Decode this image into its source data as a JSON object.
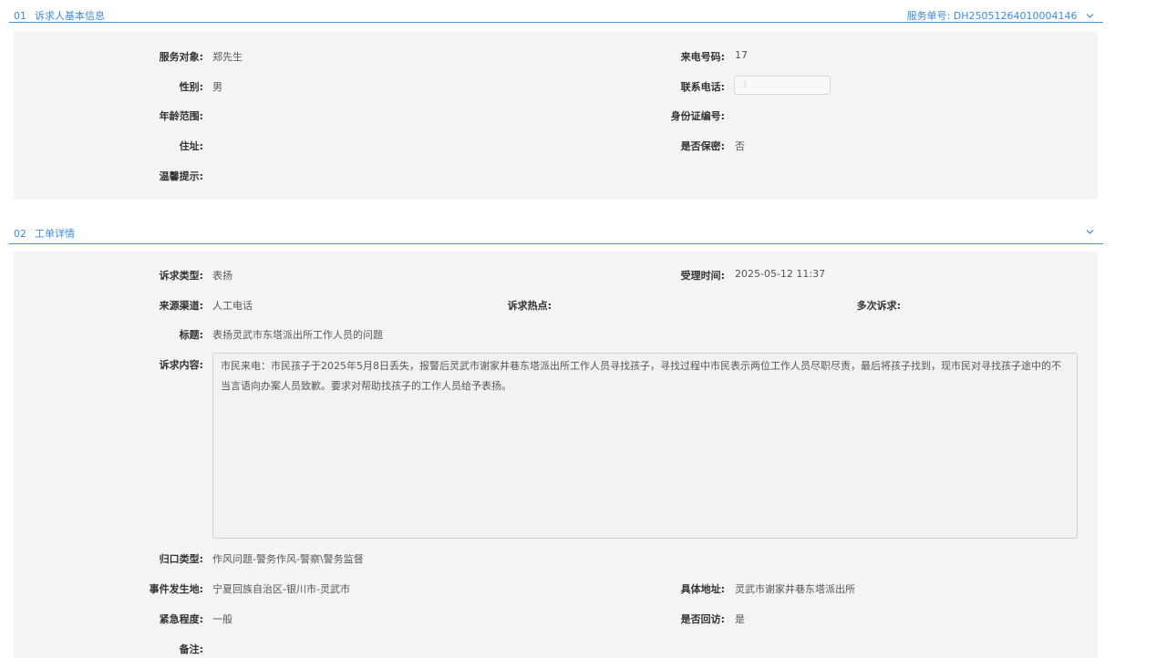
{
  "section1": {
    "num": "01",
    "title": "诉求人基本信息",
    "service_no_label": "服务单号:",
    "service_no": "DH25051264010004146",
    "fields": {
      "service_target_label": "服务对象:",
      "service_target": "郑先生",
      "caller_no_label": "来电号码:",
      "caller_no": "17",
      "gender_label": "性别:",
      "gender": "男",
      "contact_phone_label": "联系电话:",
      "contact_phone": "1",
      "age_range_label": "年龄范围:",
      "age_range": "",
      "id_no_label": "身份证编号:",
      "id_no": "",
      "address_label": "住址:",
      "address": "",
      "confidential_label": "是否保密:",
      "confidential": "否",
      "tip_label": "温馨提示:",
      "tip": ""
    }
  },
  "section2": {
    "num": "02",
    "title": "工单详情",
    "fields": {
      "type_label": "诉求类型:",
      "type": "表扬",
      "accept_time_label": "受理时间:",
      "accept_time": "2025-05-12 11:37",
      "channel_label": "来源渠道:",
      "channel": "人工电话",
      "hotspot_label": "诉求热点:",
      "hotspot": "",
      "repeat_label": "多次诉求:",
      "repeat": "",
      "subject_label": "标题:",
      "subject": "表扬灵武市东塔派出所工作人员的问题",
      "content_label": "诉求内容:",
      "content": "市民来电：市民孩子于2025年5月8日丢失，报警后灵武市谢家井巷东塔派出所工作人员寻找孩子，寻找过程中市民表示两位工作人员尽职尽责，最后将孩子找到，现市民对寻找孩子途中的不当言语向办案人员致歉。要求对帮助找孩子的工作人员给予表扬。",
      "category_label": "归口类型:",
      "category": "作风问题-警务作风-警察\\警务监督",
      "location_label": "事件发生地:",
      "location": "宁夏回族自治区-银川市-灵武市",
      "address_label": "具体地址:",
      "address": "灵武市谢家井巷东塔派出所",
      "urgency_label": "紧急程度:",
      "urgency": "一般",
      "revisit_label": "是否回访:",
      "revisit": "是",
      "remark_label": "备注:",
      "remark": ""
    }
  },
  "colors": {
    "accent": "#3b8be0",
    "panel_bg": "#f4f4f4"
  }
}
